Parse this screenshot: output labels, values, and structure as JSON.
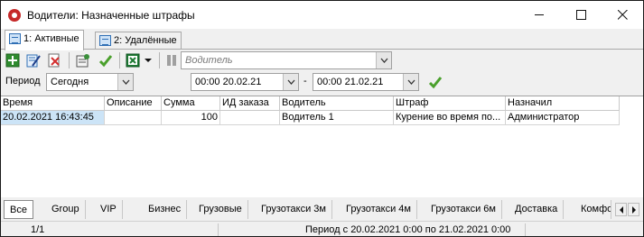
{
  "window": {
    "title": "Водители: Назначенные штрафы"
  },
  "tabs": [
    {
      "label": "1: Активные"
    },
    {
      "label": "2: Удалённые"
    }
  ],
  "toolbar": {
    "driver_placeholder": "Водитель",
    "icons": [
      "add-icon",
      "edit-icon",
      "delete-icon",
      "properties-icon",
      "apply-check-icon",
      "excel-icon",
      "dropdown-arrow-icon"
    ]
  },
  "period": {
    "label": "Период",
    "preset": "Сегодня",
    "from": "00:00 20.02.21",
    "dash": "-",
    "to": "00:00 21.02.21"
  },
  "grid": {
    "columns": [
      "Время",
      "Описание",
      "Сумма",
      "ИД заказа",
      "Водитель",
      "Штраф",
      "Назначил"
    ],
    "rows": [
      [
        "20.02.2021 16:43:45",
        "",
        "100",
        "",
        "Водитель 1",
        "Курение во время по...",
        "Администратор"
      ]
    ]
  },
  "bottom_tabs": [
    "Все",
    "Group",
    "VIP",
    "Бизнес",
    "Грузовые",
    "Грузотакси 3м",
    "Грузотакси 4м",
    "Грузотакси 6м",
    "Доставка",
    "Комфо"
  ],
  "status": {
    "count": "1/1",
    "period_text": "Период с 20.02.2021 0:00 по 21.02.2021 0:00"
  },
  "colors": {
    "selection": "#cce4f7",
    "accent_green": "#4aa02c",
    "app_icon_red": "#c62828"
  }
}
